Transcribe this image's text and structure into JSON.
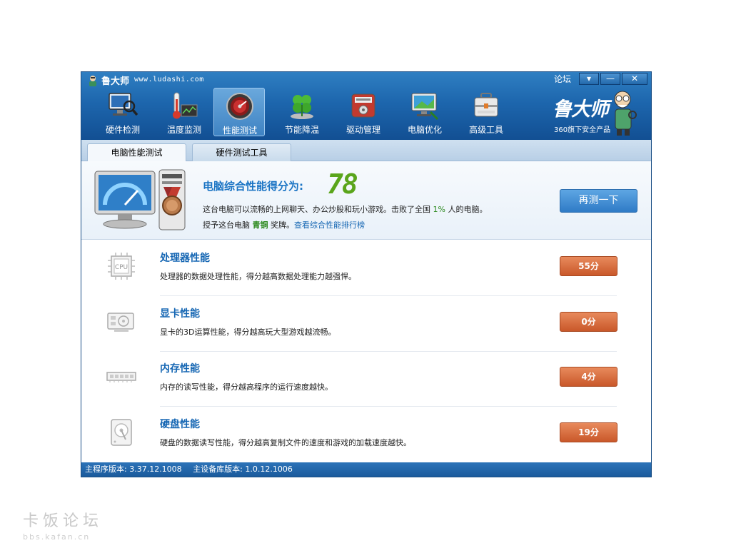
{
  "app": {
    "title": "鲁大师",
    "url": "www.ludashi.com",
    "forum_label": "论坛",
    "window_buttons": {
      "dropdown": "▾",
      "minimize": "—",
      "close": "✕"
    }
  },
  "toolbar": {
    "items": [
      {
        "label": "硬件检测",
        "icon": "monitor-magnifier-icon"
      },
      {
        "label": "温度监测",
        "icon": "thermometer-icon"
      },
      {
        "label": "性能测试",
        "icon": "speedometer-icon"
      },
      {
        "label": "节能降温",
        "icon": "clover-icon"
      },
      {
        "label": "驱动管理",
        "icon": "driver-box-icon"
      },
      {
        "label": "电脑优化",
        "icon": "monitor-optimize-icon"
      },
      {
        "label": "高级工具",
        "icon": "toolbox-icon"
      }
    ],
    "active_index": 2
  },
  "brand": {
    "name": "鲁大师",
    "subtitle": "360旗下安全产品"
  },
  "tabs": [
    {
      "label": "电脑性能测试",
      "active": true
    },
    {
      "label": "硬件测试工具",
      "active": false
    }
  ],
  "summary": {
    "heading": "电脑综合性能得分为:",
    "score": "78",
    "desc_prefix": "这台电脑可以流畅的上网聊天、办公炒股和玩小游戏。击败了全国",
    "percent": "1%",
    "desc_suffix": "人的电脑。",
    "award_prefix": "授予这台电脑",
    "award_medal": "青铜",
    "award_suffix": "奖牌。",
    "rank_link": "查看综合性能排行榜",
    "retest_label": "再测一下",
    "score_color": "#5aa51b"
  },
  "rows": [
    {
      "title": "处理器性能",
      "desc": "处理器的数据处理性能，得分越高数据处理能力越强悍。",
      "score": "55分",
      "icon": "cpu-chip-icon"
    },
    {
      "title": "显卡性能",
      "desc": "显卡的3D运算性能，得分越高玩大型游戏越流畅。",
      "score": "0分",
      "icon": "graphics-card-icon"
    },
    {
      "title": "内存性能",
      "desc": "内存的读写性能，得分越高程序的运行速度越快。",
      "score": "4分",
      "icon": "memory-stick-icon"
    },
    {
      "title": "硬盘性能",
      "desc": "硬盘的数据读写性能，得分越高复制文件的速度和游戏的加载速度越快。",
      "score": "19分",
      "icon": "hard-disk-icon"
    }
  ],
  "status": {
    "program_version": "主程序版本: 3.37.12.1008",
    "device_db_version": "主设备库版本: 1.0.12.1006"
  },
  "watermark": {
    "title": "卡饭论坛",
    "url": "bbs.kafan.cn"
  }
}
